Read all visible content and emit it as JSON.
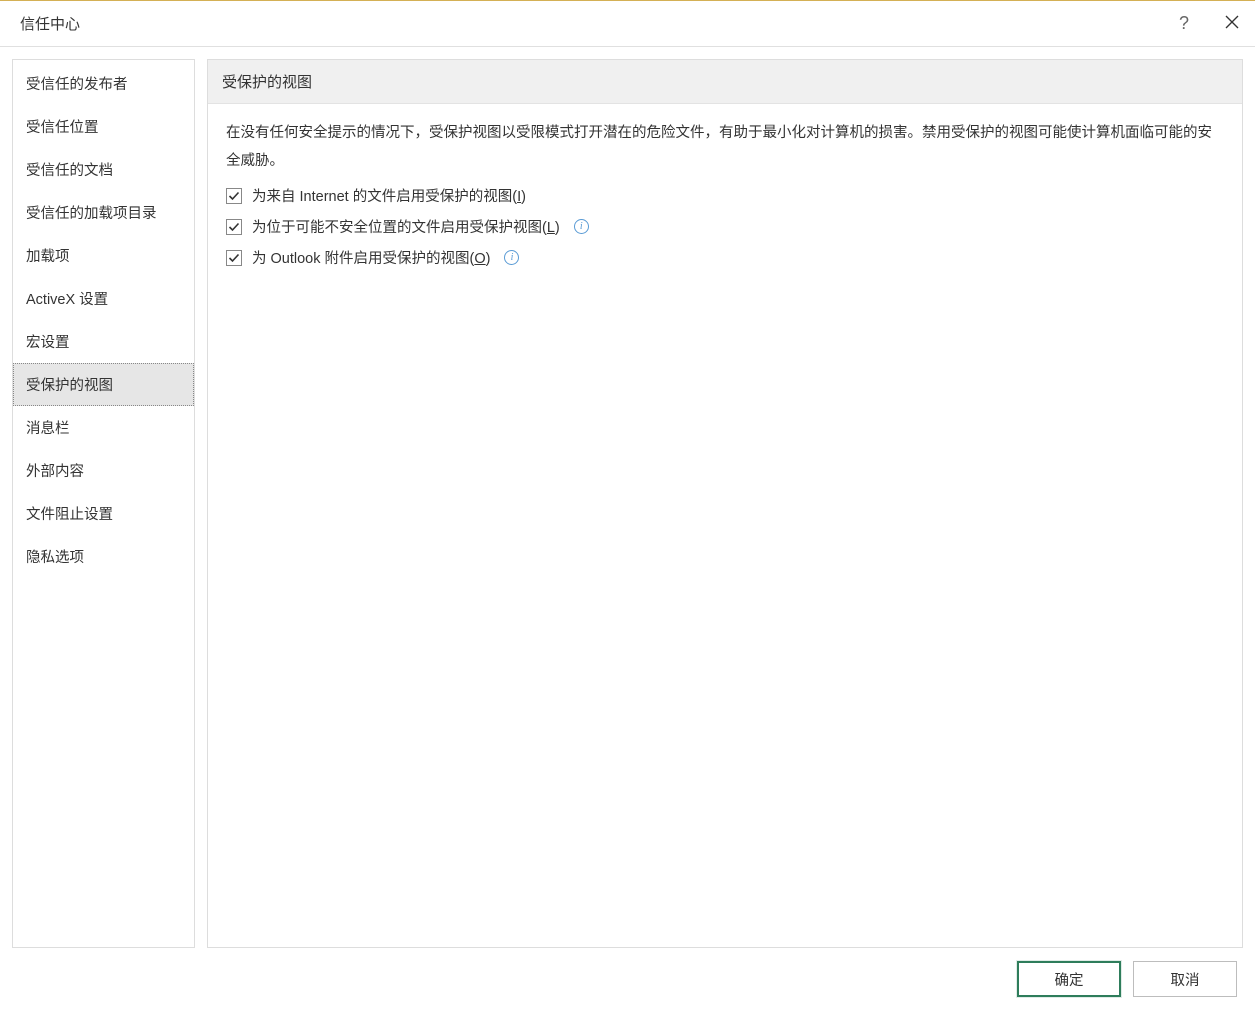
{
  "title": "信任中心",
  "sidebar": {
    "items": [
      {
        "label": "受信任的发布者",
        "selected": false
      },
      {
        "label": "受信任位置",
        "selected": false
      },
      {
        "label": "受信任的文档",
        "selected": false
      },
      {
        "label": "受信任的加载项目录",
        "selected": false
      },
      {
        "label": "加载项",
        "selected": false
      },
      {
        "label": "ActiveX 设置",
        "selected": false
      },
      {
        "label": "宏设置",
        "selected": false
      },
      {
        "label": "受保护的视图",
        "selected": true
      },
      {
        "label": "消息栏",
        "selected": false
      },
      {
        "label": "外部内容",
        "selected": false
      },
      {
        "label": "文件阻止设置",
        "selected": false
      },
      {
        "label": "隐私选项",
        "selected": false
      }
    ]
  },
  "section": {
    "heading": "受保护的视图",
    "description": "在没有任何安全提示的情况下，受保护视图以受限模式打开潜在的危险文件，有助于最小化对计算机的损害。禁用受保护的视图可能使计算机面临可能的安全威胁。",
    "options": [
      {
        "checked": true,
        "prefix": "为来自 Internet 的文件启用受保护的视图(",
        "accel": "I",
        "suffix": ")",
        "info": false
      },
      {
        "checked": true,
        "prefix": "为位于可能不安全位置的文件启用受保护视图(",
        "accel": "L",
        "suffix": ")",
        "info": true
      },
      {
        "checked": true,
        "prefix": "为 Outlook 附件启用受保护的视图(",
        "accel": "O",
        "suffix": ")",
        "info": true
      }
    ]
  },
  "buttons": {
    "ok": "确定",
    "cancel": "取消"
  },
  "info_glyph": "i"
}
